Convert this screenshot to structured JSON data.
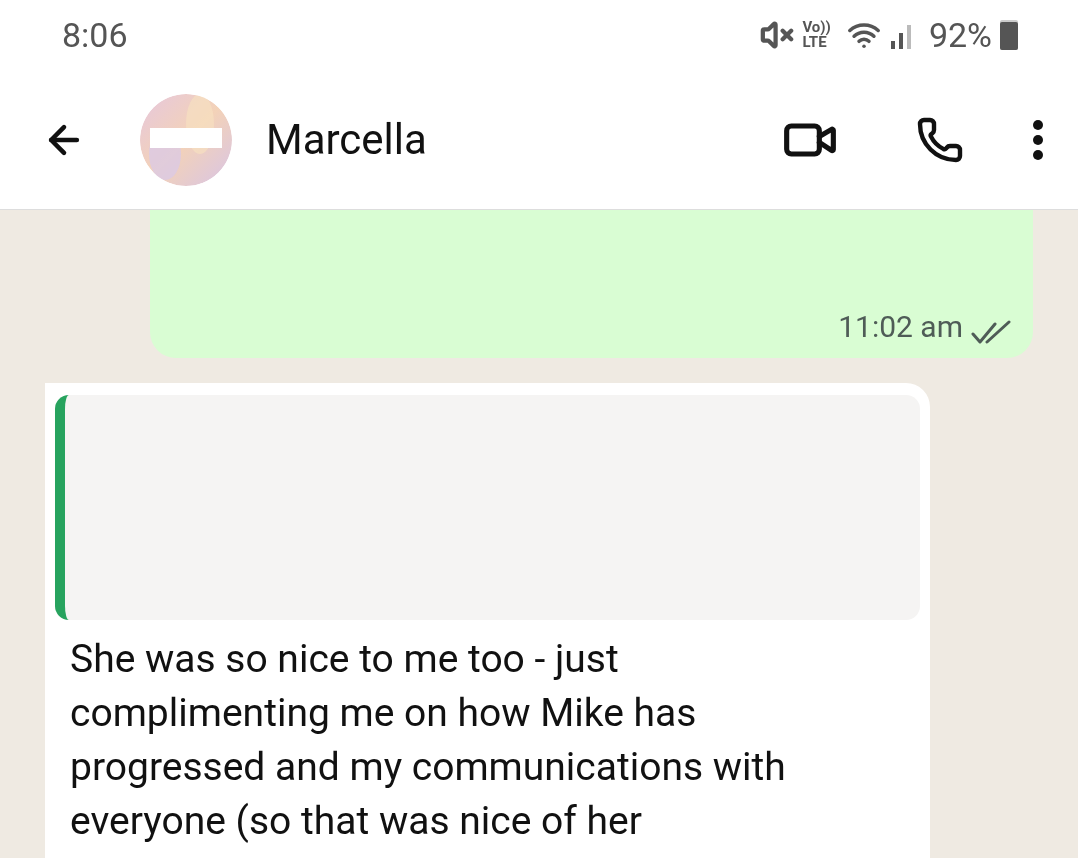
{
  "status_bar": {
    "time": "8:06",
    "volte": [
      "Vo))",
      "LTE"
    ],
    "battery": "92%"
  },
  "header": {
    "contact_name": "Marcella"
  },
  "messages": [
    {
      "kind": "sent",
      "time": "11:02 am",
      "read": false
    },
    {
      "kind": "received",
      "has_quote": true,
      "text": "She was so nice to me too - just complimenting me on how Mike has progressed and my communications with everyone (so that was nice of her"
    }
  ]
}
